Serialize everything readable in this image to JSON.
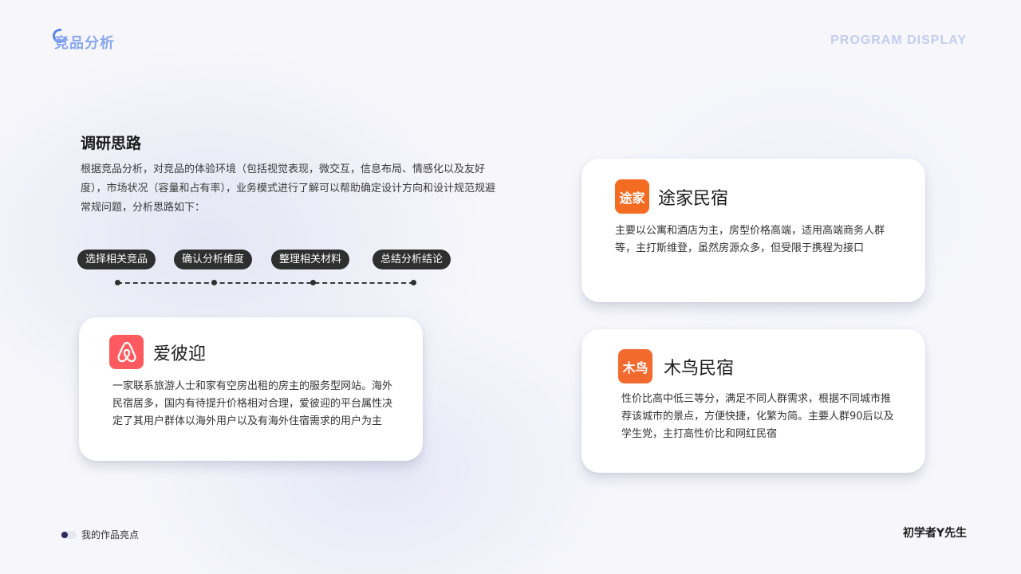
{
  "header": {
    "logo_text": "竞品分析",
    "program_label": "PROGRAM DISPLAY"
  },
  "research": {
    "title": "调研思路",
    "description": "根据竞品分析，对竞品的体验环境（包括视觉表现，微交互，信息布局、情感化以及友好度），市场状况（容量和占有率），业务模式进行了解可以帮助确定设计方向和设计规范规避常规问题，分析思路如下："
  },
  "steps": [
    {
      "label": "选择相关竞品"
    },
    {
      "label": "确认分析维度"
    },
    {
      "label": "整理相关材料"
    },
    {
      "label": "总结分析结论"
    }
  ],
  "cards": {
    "airbnb": {
      "icon": "airbnb-logo-icon",
      "color": "#ff5a5f",
      "name": "爱彼迎",
      "description": "一家联系旅游人士和家有空房出租的房主的服务型网站。海外民宿居多，国内有待提升价格相对合理，爱彼迎的平台属性决定了其用户群体以海外用户以及有海外住宿需求的用户为主"
    },
    "tujia": {
      "icon": "tujia-logo-icon",
      "icon_text": "途家",
      "color": "#f36c21",
      "name": "途家民宿",
      "description": "主要以公寓和酒店为主，房型价格高端，适用高端商务人群等，主打斯维登，虽然房源众多，但受限于携程为接口"
    },
    "muniao": {
      "icon": "muniao-logo-icon",
      "icon_text": "木鸟",
      "color": "#f26a2e",
      "name": "木鸟民宿",
      "description": "性价比高中低三等分，满足不同人群需求，根据不同城市推荐该城市的景点，方便快捷，化繁为简。主要人群90后以及学生党，主打高性价比和网红民宿"
    }
  },
  "footer": {
    "left_label": "我的作品亮点",
    "right_label": "初学者Y先生"
  }
}
